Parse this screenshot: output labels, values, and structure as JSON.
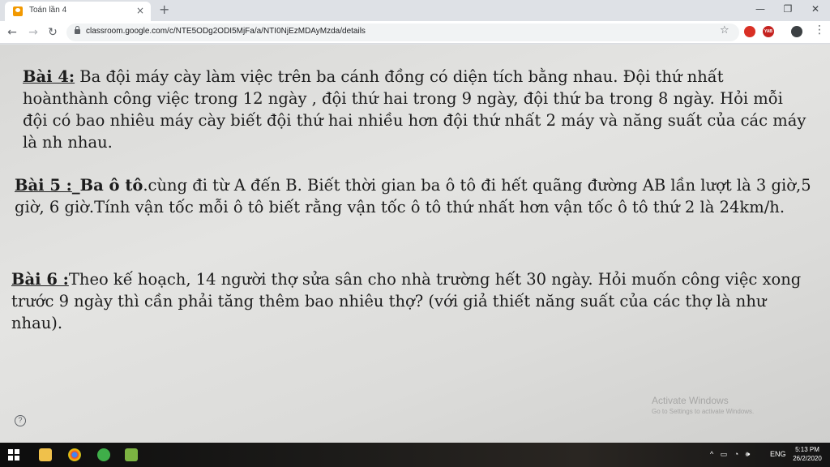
{
  "tab": {
    "title": "Toán lần 4",
    "close": "×"
  },
  "newtab": "+",
  "window_controls": {
    "minimize": "—",
    "maximize": "❐",
    "close": "✕"
  },
  "nav": {
    "back": "←",
    "forward": "→",
    "reload": "↻"
  },
  "address": {
    "url": "classroom.google.com/c/NTE5ODg2ODI5MjFa/a/NTI0NjEzMDAyMzda/details"
  },
  "toolbar": {
    "star": "☆",
    "ext_badge": "YAB",
    "menu": "⋮"
  },
  "problems": [
    {
      "label": "Bài 4:",
      "text": " Ba đội máy cày làm việc trên ba cánh đồng có diện tích bằng nhau. Đội thứ nhất hoànthành công việc trong 12 ngày , đội thứ hai trong 9 ngày, đội thứ ba trong 8 ngày. Hỏi mỗi đội có bao nhiêu máy cày biết đội thứ hai nhiều hơn đội thứ nhất 2 máy và năng suất của các máy là nh nhau."
    },
    {
      "label": "Bài 5 :",
      "bold_part": "_Ba ô tô",
      "text": ".cùng đi từ A đến B. Biết thời gian ba ô tô đi hết quãng đường AB lần lượt là 3 giờ,5 giờ, 6 giờ.Tính vận tốc mỗi ô tô biết rằng vận tốc ô tô thứ nhất hơn vận tốc ô tô thứ 2 là 24km/h."
    },
    {
      "label": "Bài 6 :",
      "text": "Theo kế hoạch, 14 người thợ sửa sân cho nhà trường hết 30 ngày. Hỏi muốn công việc xong trước 9 ngày thì cần phải tăng thêm bao nhiêu thợ? (với giả thiết năng suất của các thợ là như nhau)."
    }
  ],
  "help": "?",
  "watermark": {
    "line1": "Activate Windows",
    "line2": "Go to Settings to activate Windows."
  },
  "taskbar": {
    "language": "ENG",
    "time": "5:13 PM",
    "date": "26/2/2020",
    "tray_icons": "^ ▭ ◔ 🕪"
  },
  "colors": {
    "tab_bg": "#dee1e6",
    "accent": "#f29900",
    "chrome": "#4285f4"
  }
}
